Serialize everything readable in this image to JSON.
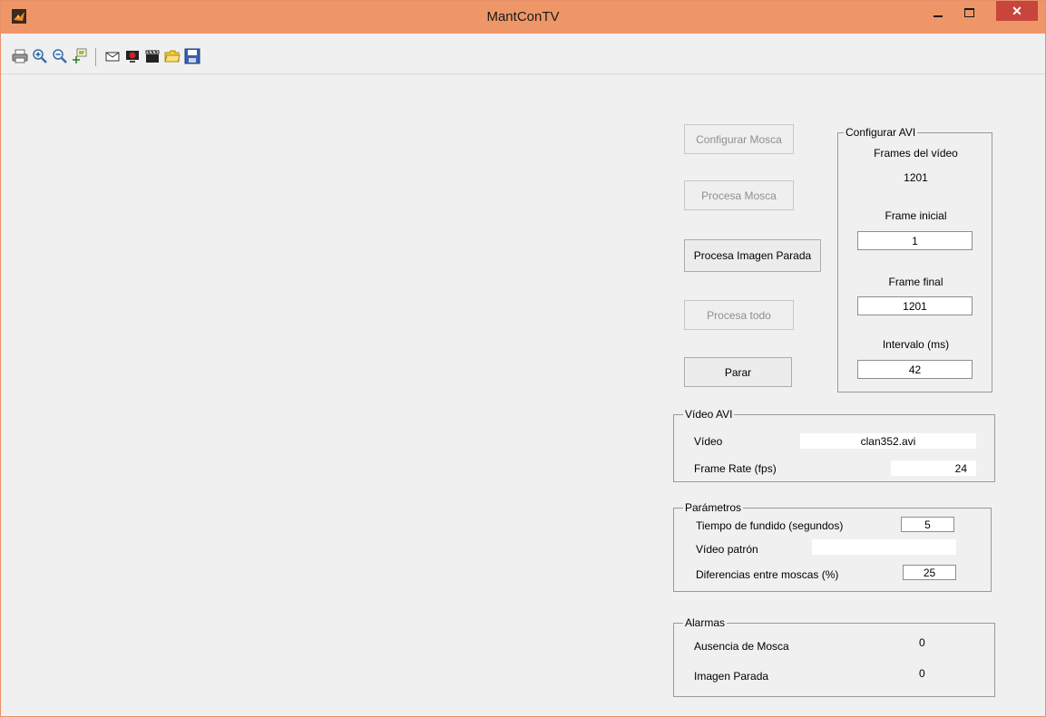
{
  "window": {
    "title": "MantConTV"
  },
  "toolbar": {
    "icons": [
      "print-icon",
      "zoom-in-icon",
      "zoom-out-icon",
      "data-cursor-icon",
      "envelope-icon",
      "camera-icon",
      "clapperboard-icon",
      "open-folder-icon",
      "save-icon"
    ]
  },
  "buttons": {
    "configurar_mosca": "Configurar Mosca",
    "procesa_mosca": "Procesa Mosca",
    "procesa_imagen_parada": "Procesa Imagen Parada",
    "procesa_todo": "Procesa todo",
    "parar": "Parar"
  },
  "configurar_avi": {
    "title": "Configurar AVI",
    "frames_label": "Frames del vídeo",
    "frames_value": "1201",
    "frame_inicial_label": "Frame inicial",
    "frame_inicial_value": "1",
    "frame_final_label": "Frame final",
    "frame_final_value": "1201",
    "intervalo_label": "Intervalo (ms)",
    "intervalo_value": "42"
  },
  "video_avi": {
    "title": "Vídeo AVI",
    "video_label": "Vídeo",
    "video_value": "clan352.avi",
    "fps_label": "Frame Rate (fps)",
    "fps_value": "24"
  },
  "parametros": {
    "title": "Parámetros",
    "tiempo_label": "Tiempo de fundido (segundos)",
    "tiempo_value": "5",
    "patron_label": "Vídeo patrón",
    "patron_value": "",
    "diferencias_label": "Diferencias entre moscas (%)",
    "diferencias_value": "25"
  },
  "alarmas": {
    "title": "Alarmas",
    "ausencia_label": "Ausencia de Mosca",
    "ausencia_value": "0",
    "imagen_label": "Imagen Parada",
    "imagen_value": "0"
  },
  "colors": {
    "titlebar": "#ee9667",
    "close": "#c7453c",
    "background": "#f0f0f0"
  }
}
